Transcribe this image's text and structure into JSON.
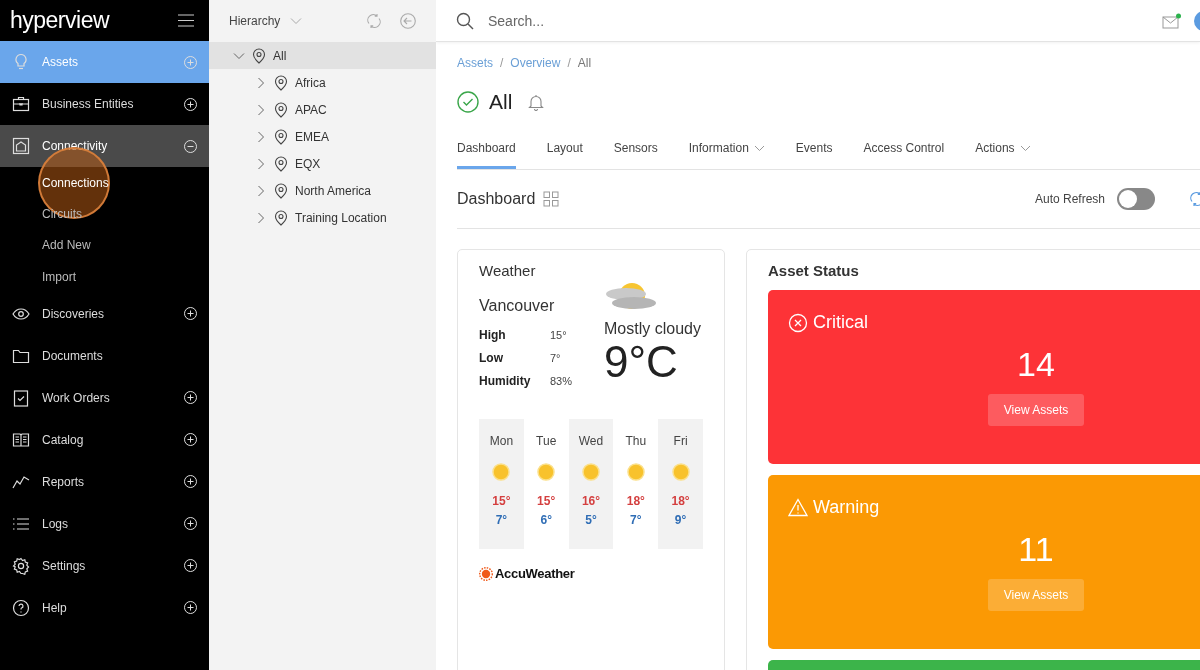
{
  "logo": "hyperview",
  "sidebar": {
    "items": [
      {
        "label": "Assets",
        "selected": true,
        "expandable": true,
        "expanded": false
      },
      {
        "label": "Business Entities",
        "selected": false,
        "expandable": true,
        "expanded": false
      },
      {
        "label": "Connectivity",
        "selected": false,
        "expandable": true,
        "expanded": true,
        "children": [
          {
            "label": "Connections",
            "selected": true
          },
          {
            "label": "Circuits",
            "selected": false
          },
          {
            "label": "Add New",
            "selected": false
          },
          {
            "label": "Import",
            "selected": false
          }
        ]
      },
      {
        "label": "Discoveries",
        "selected": false,
        "expandable": true,
        "expanded": false
      },
      {
        "label": "Documents",
        "selected": false,
        "expandable": false,
        "expanded": false
      },
      {
        "label": "Work Orders",
        "selected": false,
        "expandable": true,
        "expanded": false
      },
      {
        "label": "Catalog",
        "selected": false,
        "expandable": true,
        "expanded": false
      },
      {
        "label": "Reports",
        "selected": false,
        "expandable": true,
        "expanded": false
      },
      {
        "label": "Logs",
        "selected": false,
        "expandable": true,
        "expanded": false
      },
      {
        "label": "Settings",
        "selected": false,
        "expandable": true,
        "expanded": false
      },
      {
        "label": "Help",
        "selected": false,
        "expandable": true,
        "expanded": false
      }
    ]
  },
  "tree_panel": {
    "view": "Hierarchy",
    "tree": [
      {
        "label": "All",
        "selected": true,
        "expanded": true,
        "children": [
          {
            "label": "Africa",
            "selected": false,
            "expanded": false
          },
          {
            "label": "APAC",
            "selected": false,
            "expanded": false
          },
          {
            "label": "EMEA",
            "selected": false,
            "expanded": false
          },
          {
            "label": "EQX",
            "selected": false,
            "expanded": false
          },
          {
            "label": "North America",
            "selected": false,
            "expanded": false
          },
          {
            "label": "Training Location",
            "selected": false,
            "expanded": false
          }
        ]
      }
    ]
  },
  "search": {
    "placeholder": "Search..."
  },
  "breadcrumbs": [
    {
      "kind": "link",
      "label": "Assets"
    },
    {
      "kind": "separator",
      "label": "/"
    },
    {
      "kind": "link",
      "label": "Overview"
    },
    {
      "kind": "separator",
      "label": "/"
    },
    {
      "kind": "current",
      "label": "All"
    }
  ],
  "title": "All",
  "tabs": [
    {
      "label": "Dashboard",
      "selected": true,
      "dropdown": false
    },
    {
      "label": "Layout",
      "selected": false,
      "dropdown": false
    },
    {
      "label": "Sensors",
      "selected": false,
      "dropdown": false
    },
    {
      "label": "Information",
      "selected": false,
      "dropdown": true
    },
    {
      "label": "Events",
      "selected": false,
      "dropdown": false
    },
    {
      "label": "Access Control",
      "selected": false,
      "dropdown": false
    },
    {
      "label": "Actions",
      "selected": false,
      "dropdown": true
    }
  ],
  "dashboard": {
    "heading": "Dashboard",
    "auto_refresh": {
      "label": "Auto Refresh",
      "on": false
    }
  },
  "weather": {
    "title": "Weather",
    "city": "Vancouver",
    "condition": "Mostly cloudy",
    "temperature": "9°C",
    "stats": [
      {
        "label": "High",
        "value": "15°"
      },
      {
        "label": "Low",
        "value": "7°"
      },
      {
        "label": "Humidity",
        "value": "83%"
      }
    ],
    "forecast": [
      {
        "day": "Mon",
        "high": "15°",
        "low": "7°"
      },
      {
        "day": "Tue",
        "high": "15°",
        "low": "6°"
      },
      {
        "day": "Wed",
        "high": "16°",
        "low": "5°"
      },
      {
        "day": "Thu",
        "high": "18°",
        "low": "7°"
      },
      {
        "day": "Fri",
        "high": "18°",
        "low": "9°"
      }
    ],
    "provider": "AccuWeather"
  },
  "asset_status": {
    "title": "Asset Status",
    "cards": [
      {
        "kind": "critical",
        "label": "Critical",
        "count": "14",
        "button": "View Assets",
        "color": "#fd3337"
      },
      {
        "kind": "warning",
        "label": "Warning",
        "count": "11",
        "button": "View Assets",
        "color": "#fb9904"
      },
      {
        "color": "#3cb44a"
      }
    ]
  }
}
